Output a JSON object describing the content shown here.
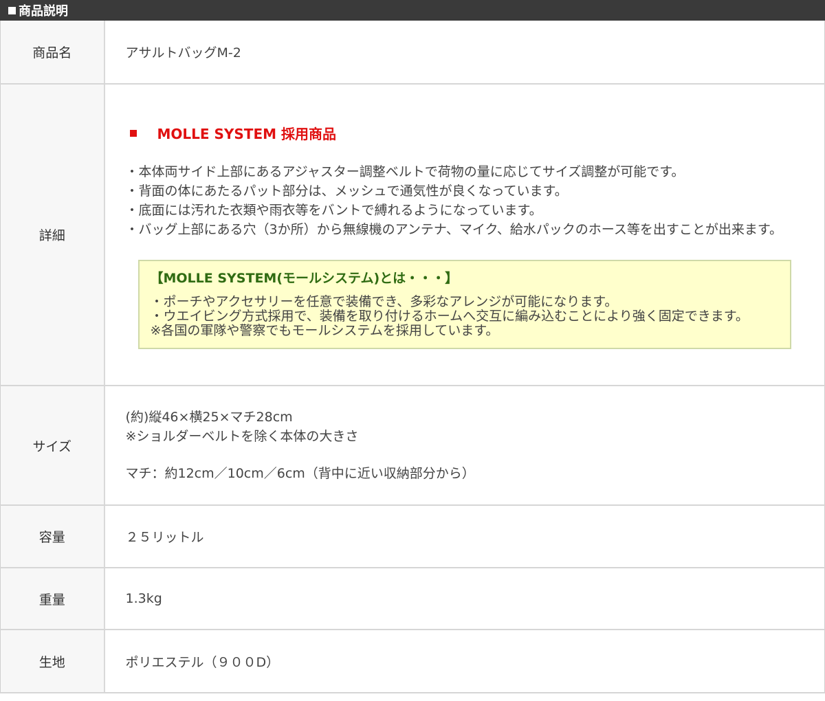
{
  "header": {
    "title": "商品説明"
  },
  "rows": {
    "name": {
      "label": "商品名",
      "value": "アサルトバッグM-2"
    },
    "detail": {
      "label": "詳細",
      "molle_heading": "MOLLE SYSTEM 採用商品",
      "bullets": [
        "・本体両サイド上部にあるアジャスター調整ベルトで荷物の量に応じてサイズ調整が可能です。",
        "・背面の体にあたるパット部分は、メッシュで通気性が良くなっています。",
        "・底面には汚れた衣類や雨衣等をバントで縛れるようになっています。",
        "・バッグ上部にある穴（3か所）から無線機のアンテナ、マイク、給水パックのホース等を出すことが出来ます。"
      ],
      "note": {
        "title": "【MOLLE SYSTEM(モールシステム)とは・・・】",
        "lines": [
          "・ポーチやアクセサリーを任意で装備でき、多彩なアレンジが可能になります。",
          "・ウエイビング方式採用で、装備を取り付けるホームへ交互に編み込むことにより強く固定できます。",
          "※各国の軍隊や警察でもモールシステムを採用しています。"
        ]
      }
    },
    "size": {
      "label": "サイズ",
      "line1": "(約)縦46×横25×マチ28cm",
      "line2": "※ショルダーベルトを除く本体の大きさ",
      "line3": "マチ：約12cm／10cm／6cm（背中に近い収納部分から）"
    },
    "capacity": {
      "label": "容量",
      "value": "２５リットル"
    },
    "weight": {
      "label": "重量",
      "value": "1.3kg"
    },
    "fabric": {
      "label": "生地",
      "value": "ポリエステル（９００D）"
    }
  },
  "colors": {
    "header_bg": "#3a3a3a",
    "accent_red": "#e01010",
    "note_bg": "#ffffcc",
    "note_title": "#2f6b12"
  }
}
